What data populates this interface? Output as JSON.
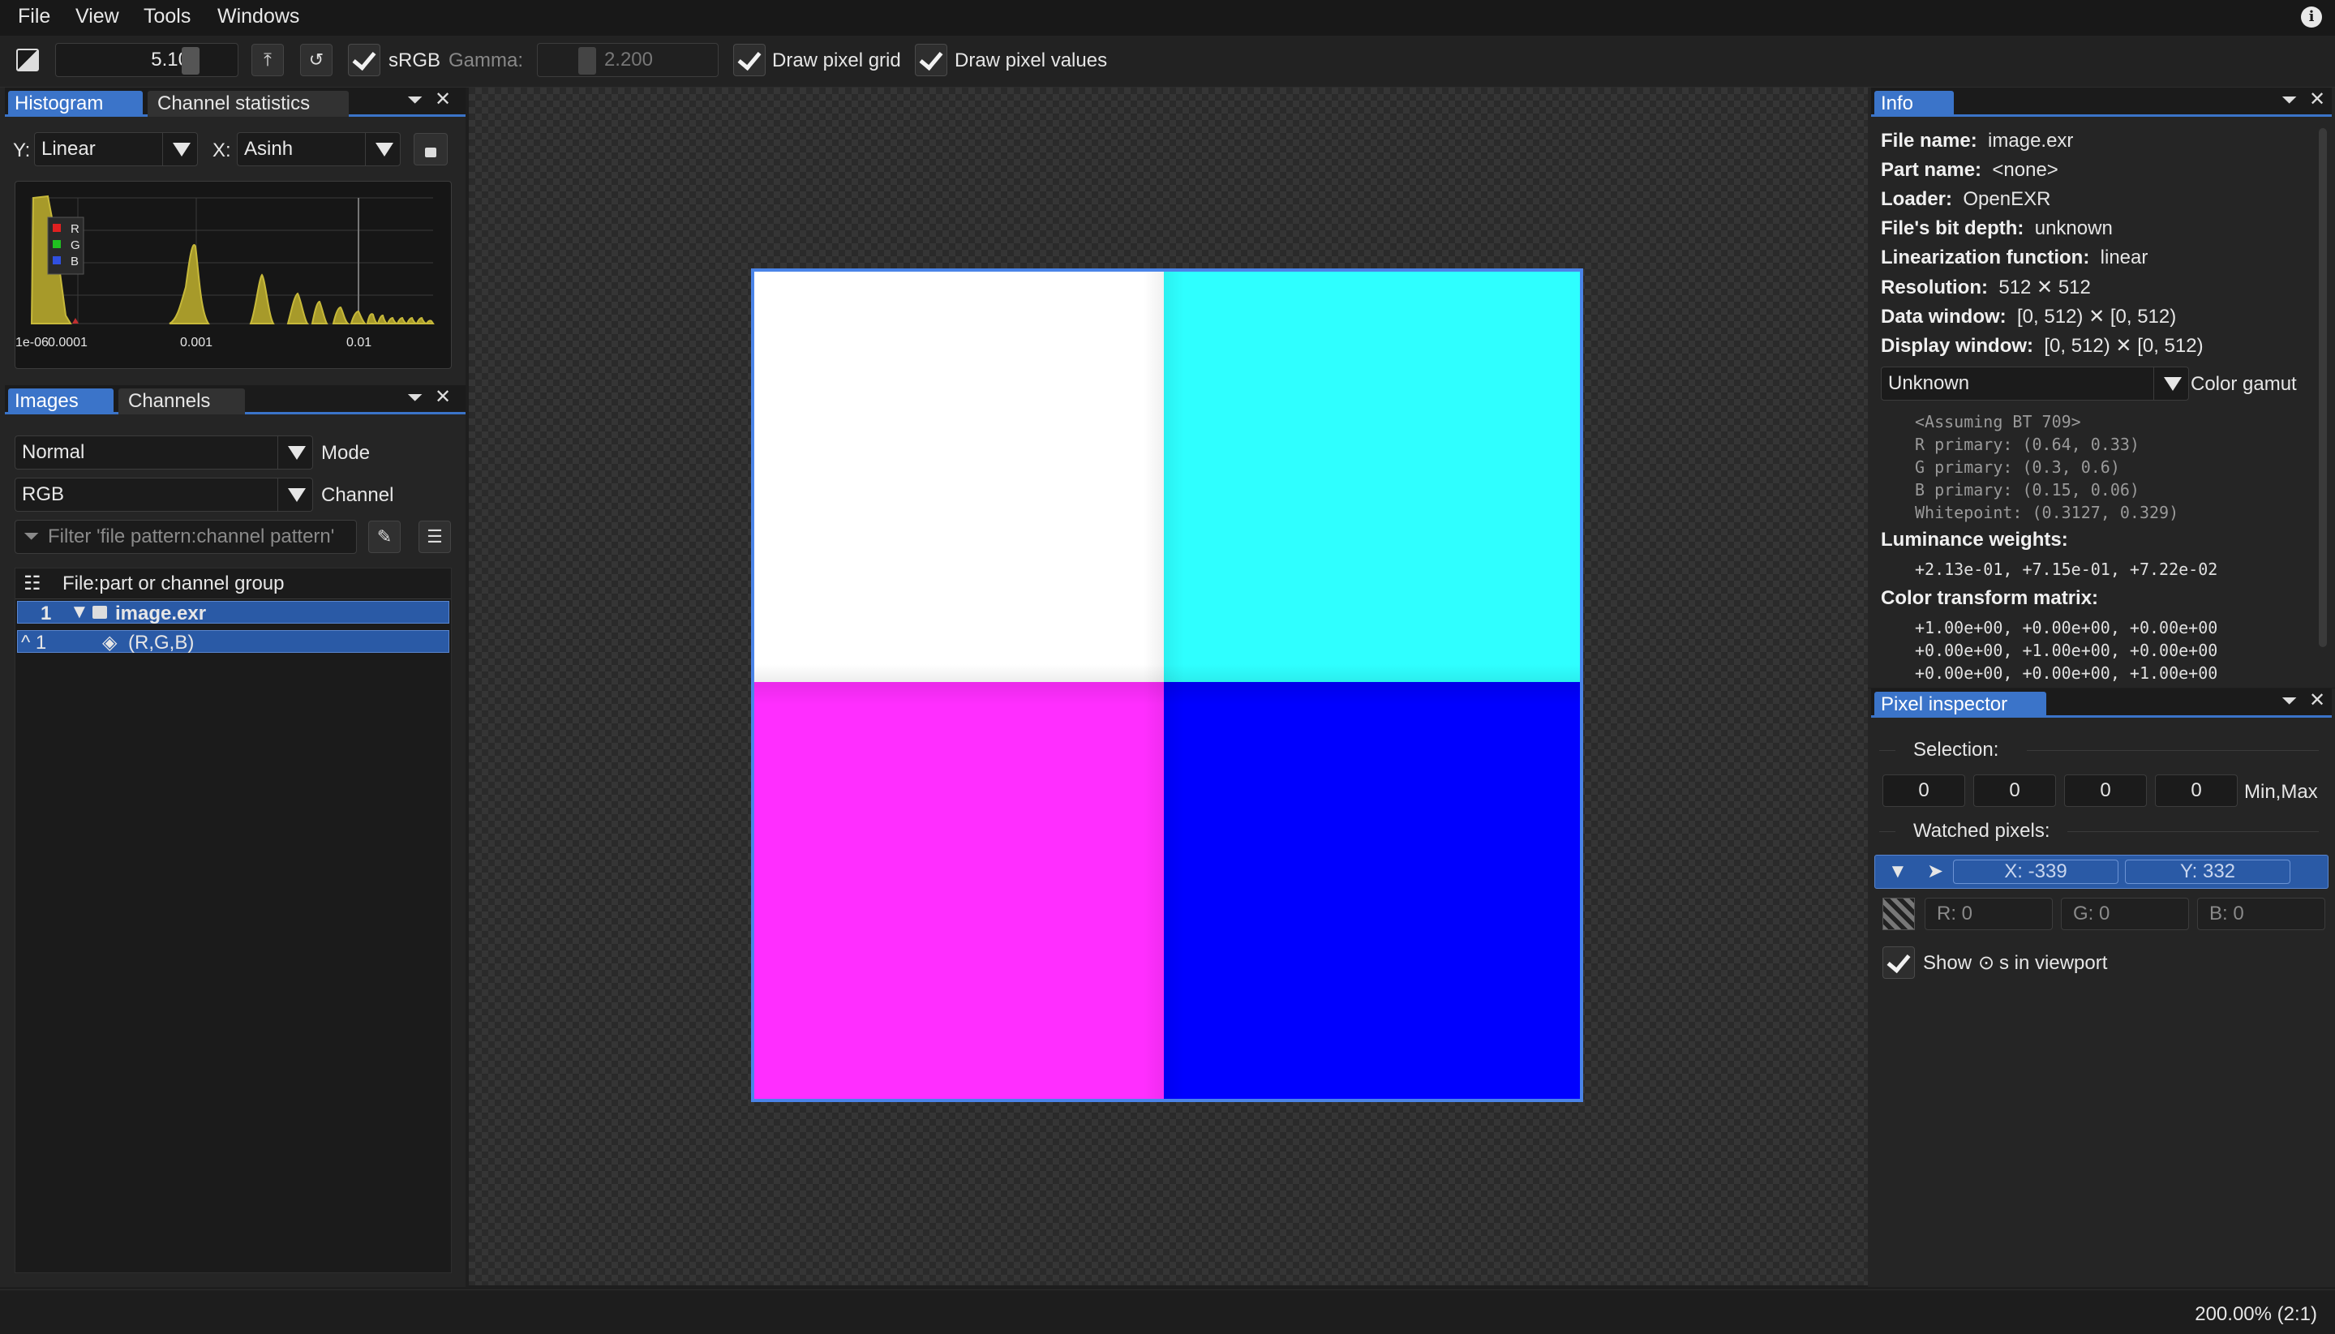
{
  "menubar": {
    "items": [
      "File",
      "View",
      "Tools",
      "Windows"
    ]
  },
  "toolbar": {
    "exposure": "5.10",
    "srgb_label": "sRGB",
    "gamma_label": "Gamma:",
    "gamma_value": "2.200",
    "draw_grid_label": "Draw pixel grid",
    "draw_values_label": "Draw pixel values"
  },
  "histogram_panel": {
    "tabs": [
      "Histogram",
      "Channel statistics"
    ],
    "y_label": "Y:",
    "y_scale": "Linear",
    "x_label": "X:",
    "x_scale": "Asinh",
    "legend": [
      "R",
      "G",
      "B"
    ],
    "ticks": [
      "1e-06",
      "0.0001",
      "0.001",
      "0.01"
    ]
  },
  "images_panel": {
    "tabs": [
      "Images",
      "Channels"
    ],
    "mode_value": "Normal",
    "mode_label": "Mode",
    "channel_value": "RGB",
    "channel_label": "Channel",
    "filter_placeholder": "Filter 'file pattern:channel pattern'",
    "list_header": "File:part or channel group",
    "rows": [
      {
        "index": "1",
        "name": "image.exr"
      },
      {
        "index": "^ 1",
        "name": "(R,G,B)"
      }
    ]
  },
  "info_panel": {
    "tab": "Info",
    "fields": [
      {
        "key": "File name:",
        "value": "image.exr"
      },
      {
        "key": "Part name:",
        "value": "<none>"
      },
      {
        "key": "Loader:",
        "value": "OpenEXR"
      },
      {
        "key": "File's bit depth:",
        "value": "unknown"
      },
      {
        "key": "Linearization function:",
        "value": "linear"
      },
      {
        "key": "Resolution:",
        "value": "512 ✕ 512"
      },
      {
        "key": "Data window:",
        "value": "[0, 512) ✕ [0, 512)"
      },
      {
        "key": "Display window:",
        "value": "[0, 512) ✕ [0, 512)"
      }
    ],
    "gamut_value": "Unknown",
    "gamut_label": "Color gamut",
    "gamut_lines": [
      "<Assuming BT 709>",
      "R primary: (0.64, 0.33)",
      "G primary: (0.3, 0.6)",
      "B primary: (0.15, 0.06)",
      "Whitepoint: (0.3127, 0.329)"
    ],
    "luminance_label": "Luminance weights:",
    "luminance_value": "+2.13e-01, +7.15e-01, +7.22e-02",
    "matrix_label": "Color transform matrix:",
    "matrix_rows": [
      "+1.00e+00, +0.00e+00, +0.00e+00",
      "+0.00e+00, +1.00e+00, +0.00e+00",
      "+0.00e+00, +0.00e+00, +1.00e+00"
    ]
  },
  "pixel_inspector": {
    "tab": "Pixel inspector",
    "selection_label": "Selection:",
    "selection_values": [
      "0",
      "0",
      "0",
      "0"
    ],
    "minmax_label": "Min,Max",
    "watched_label": "Watched pixels:",
    "x_value": "X: -339",
    "y_value": "Y: 332",
    "r_value": "R: 0",
    "g_value": "G: 0",
    "b_value": "B: 0",
    "show_label_pre": "Show",
    "show_label_post": "s in viewport"
  },
  "status": {
    "zoom": "200.00% (2:1)"
  },
  "colors": {
    "accent": "#3b74c9",
    "white": "#ffffff",
    "cyan": "#2effff",
    "magenta": "#ff2eff",
    "blue": "#0000ff"
  }
}
